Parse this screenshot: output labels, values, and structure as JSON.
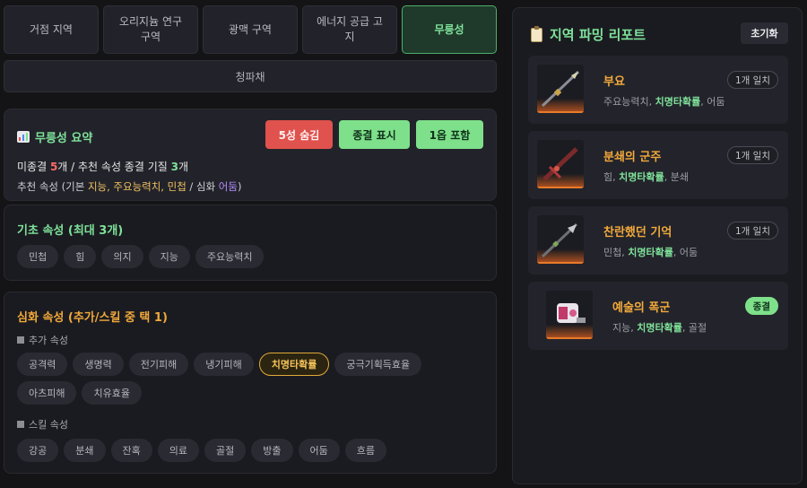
{
  "tabs": [
    {
      "label": "거점 지역",
      "active": false
    },
    {
      "label": "오리지늄 연구 구역",
      "active": false
    },
    {
      "label": "광맥 구역",
      "active": false
    },
    {
      "label": "에너지 공급 고지",
      "active": false
    },
    {
      "label": "무릉성",
      "active": true
    }
  ],
  "subtab": {
    "label": "청파채"
  },
  "summary": {
    "title": "무릉성 요약",
    "icon": "bar-chart-icon",
    "buttons": {
      "hide_5star": "5성 숨김",
      "show_final": "종결 표시",
      "include_1": "1옵 포함"
    },
    "line1": {
      "prefix": "미종결 ",
      "count": "5",
      "mid": "개 / 추천 속성 종결 기질 ",
      "count2": "3",
      "suffix": "개"
    },
    "line2": {
      "prefix": "추천 속성 (기본 ",
      "base": "지능, 주요능력치, 민첩",
      "mid": " / 심화 ",
      "adv": "어둠",
      "suffix": ")"
    }
  },
  "basic": {
    "title": "기초 속성 (최대 3개)",
    "chips": [
      "민첩",
      "힘",
      "의지",
      "지능",
      "주요능력치"
    ]
  },
  "advanced": {
    "title": "심화 속성 (추가/스킬 중 택 1)",
    "extra_label": "추가 속성",
    "extra_chips": [
      "공격력",
      "생명력",
      "전기피해",
      "냉기피해",
      "치명타확률",
      "궁극기획득효율",
      "아츠피해",
      "치유효율"
    ],
    "selected_chip": "치명타확률",
    "skill_label": "스킬 속성",
    "skill_chips": [
      "강공",
      "분쇄",
      "잔혹",
      "의료",
      "골절",
      "방출",
      "어둠",
      "흐름"
    ]
  },
  "report": {
    "title": "지역 파밍 리포트",
    "reset_label": "초기화",
    "cards": [
      {
        "name": "부요",
        "stats_a": "주요능력치, ",
        "stats_hl": "치명타확률",
        "stats_b": ", 어둠",
        "badge": "1개 일치"
      },
      {
        "name": "분쇄의 군주",
        "stats_a": "힘, ",
        "stats_hl": "치명타확률",
        "stats_b": ", 분쇄",
        "badge": "1개 일치"
      },
      {
        "name": "찬란했던 기억",
        "stats_a": "민첩, ",
        "stats_hl": "치명타확률",
        "stats_b": ", 어둠",
        "badge": "1개 일치"
      },
      {
        "name": "예술의 폭군",
        "stats_a": "지능, ",
        "stats_hl": "치명타확률",
        "stats_b": ", 골절",
        "badge": "종결"
      }
    ]
  },
  "colors": {
    "accent_green": "#7fe29a",
    "accent_orange": "#f2a93b",
    "danger": "#e0524d",
    "selected_gold": "#e0a93b"
  }
}
